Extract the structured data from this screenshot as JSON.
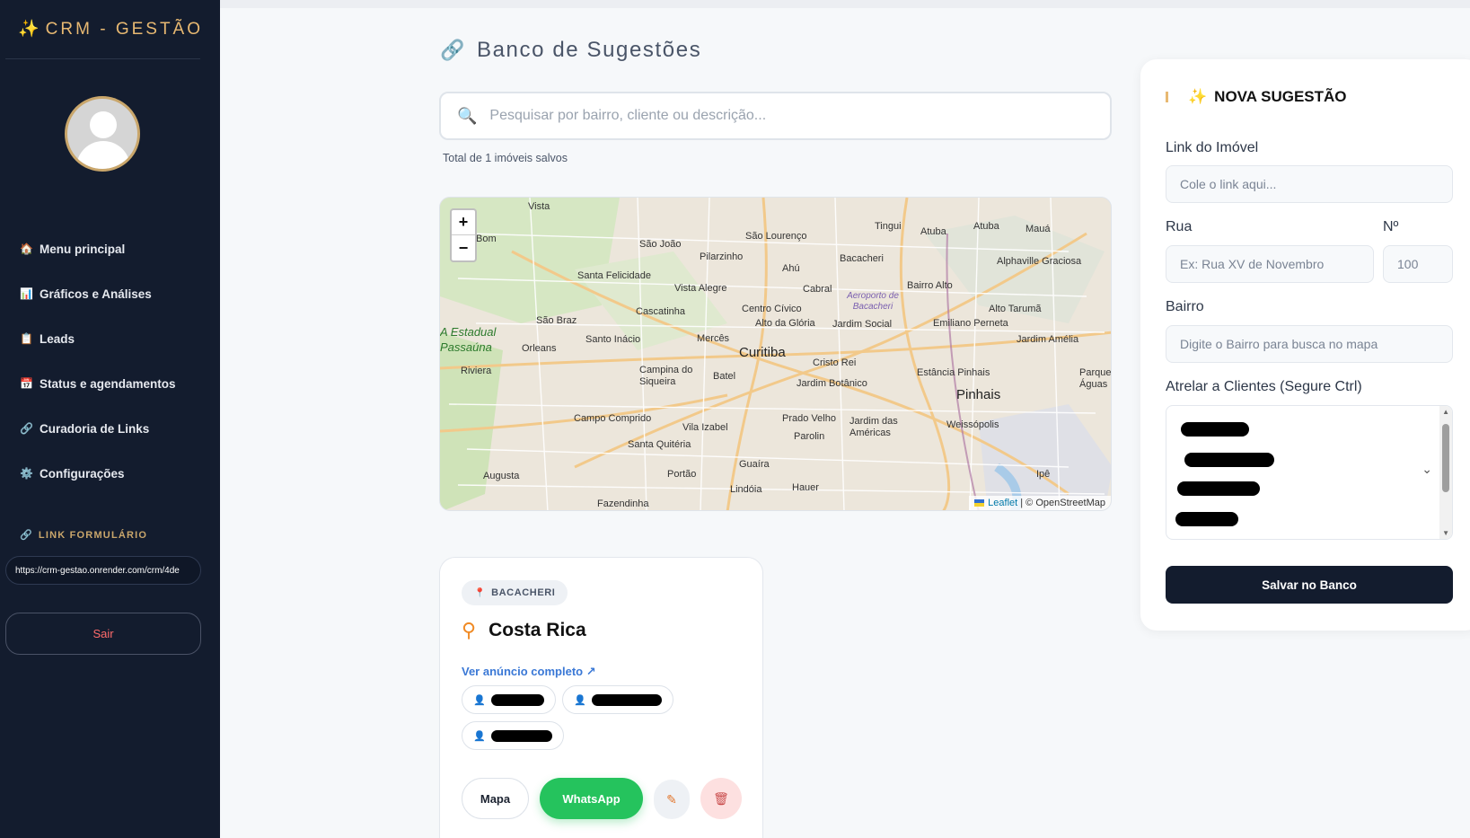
{
  "sidebar": {
    "brand": "CRM - GESTÃO",
    "nav": [
      {
        "icon": "house-icon",
        "glyph": "🏠",
        "label": "Menu principal"
      },
      {
        "icon": "bar-chart-icon",
        "glyph": "📊",
        "label": "Gráficos e Análises"
      },
      {
        "icon": "clipboard-icon",
        "glyph": "📋",
        "label": "Leads"
      },
      {
        "icon": "calendar-icon",
        "glyph": "📅",
        "label": "Status e agendamentos"
      },
      {
        "icon": "link-icon",
        "glyph": "🔗",
        "label": "Curadoria de Links"
      },
      {
        "icon": "gear-icon",
        "glyph": "⚙️",
        "label": "Configurações"
      }
    ],
    "form_link_title": "LINK FORMULÁRIO",
    "form_link_value": "https://crm-gestao.onrender.com/crm/4de",
    "logout_label": "Sair"
  },
  "main": {
    "title": "Banco de Sugestões",
    "search_placeholder": "Pesquisar por bairro, cliente ou descrição...",
    "total_text": "Total de 1 imóveis salvos",
    "map": {
      "labels": [
        "Vista",
        "Bom",
        "São João",
        "São Lourenço",
        "Tingui",
        "Atuba",
        "Atuba",
        "Mauá",
        "Pilarzinho",
        "Bacacheri",
        "Santa Felicidade",
        "Ahú",
        "Alphaville Graciosa",
        "Vista Alegre",
        "Cabral",
        "Bairro Alto",
        "Cascatinha",
        "Centro Cívico",
        "Alto Tarumã",
        "São Braz",
        "Alto da Glória",
        "Jardim Social",
        "Emiliano Perneta",
        "Orleans",
        "Santo Inácio",
        "Mercês",
        "Jardim Amélia",
        "Curitiba",
        "Cristo Rei",
        "Riviera",
        "Campina do Siqueira",
        "Batel",
        "Jardim Botânico",
        "Estância Pinhais",
        "Parque Águas",
        "Pinhais",
        "Campo Comprido",
        "Vila Izabel",
        "Prado Velho",
        "Jardim das Américas",
        "Weissópolis",
        "Parolin",
        "Santa Quitéria",
        "Guaíra",
        "Augusta",
        "Portão",
        "Lindóia",
        "Hauer",
        "Ipê",
        "Fazendinha"
      ],
      "park_label": "A Estadual Passaúna",
      "airport_label": "Aeroporto de Bacacheri",
      "zoom_in": "+",
      "zoom_out": "−",
      "attribution_leaflet": "Leaflet",
      "attribution_osm": "| © OpenStreetMap"
    },
    "card": {
      "neighborhood": "BACACHERI",
      "title": "Costa Rica",
      "link_label": "Ver anúncio completo ↗",
      "map_button": "Mapa",
      "whatsapp_button": "WhatsApp"
    }
  },
  "panel": {
    "title": "NOVA SUGESTÃO",
    "link_label": "Link do Imóvel",
    "link_placeholder": "Cole o link aqui...",
    "street_label": "Rua",
    "street_placeholder": "Ex: Rua XV de Novembro",
    "number_label": "Nº",
    "number_placeholder": "100",
    "bairro_label": "Bairro",
    "bairro_placeholder": "Digite o Bairro para busca no mapa",
    "clients_label": "Atrelar a Clientes (Segure Ctrl)",
    "save_label": "Salvar no Banco"
  },
  "colors": {
    "sidebar_bg": "#131c2e",
    "accent_gold": "#e8b972",
    "whatsapp_green": "#25c35d",
    "link_blue": "#3a78d6",
    "logout_red": "#ff6b6b"
  }
}
